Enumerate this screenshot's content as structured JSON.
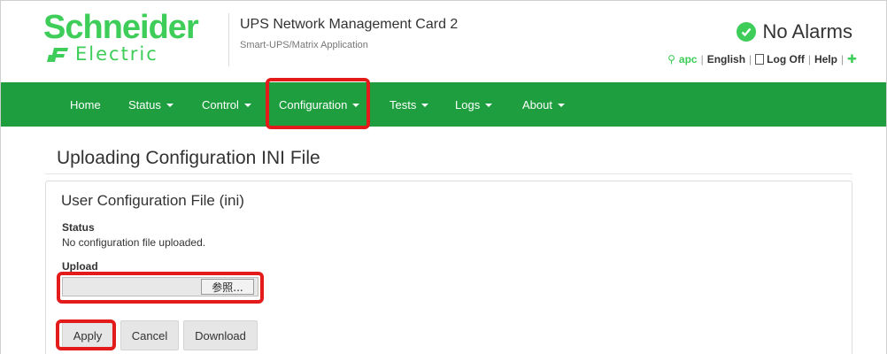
{
  "header": {
    "brand_top": "Schneider",
    "brand_bottom": "Electric",
    "app_title": "UPS Network Management Card 2",
    "app_subtitle": "Smart-UPS/Matrix Application",
    "alarm_status": "No Alarms",
    "links": {
      "apc": "apc",
      "language": "English",
      "logoff": "Log Off",
      "help": "Help"
    }
  },
  "nav": {
    "items": [
      {
        "label": "Home"
      },
      {
        "label": "Status"
      },
      {
        "label": "Control"
      },
      {
        "label": "Configuration"
      },
      {
        "label": "Tests"
      },
      {
        "label": "Logs"
      },
      {
        "label": "About"
      }
    ]
  },
  "page": {
    "title": "Uploading Configuration INI File"
  },
  "panel": {
    "title": "User Configuration File (ini)",
    "status_label": "Status",
    "status_text": "No configuration file uploaded.",
    "upload_label": "Upload",
    "browse_label": "参照...",
    "buttons": {
      "apply": "Apply",
      "cancel": "Cancel",
      "download": "Download"
    }
  },
  "colors": {
    "brand_green": "#3dcd58",
    "nav_green": "#1e9e3e",
    "highlight_red": "#e31b1b"
  }
}
